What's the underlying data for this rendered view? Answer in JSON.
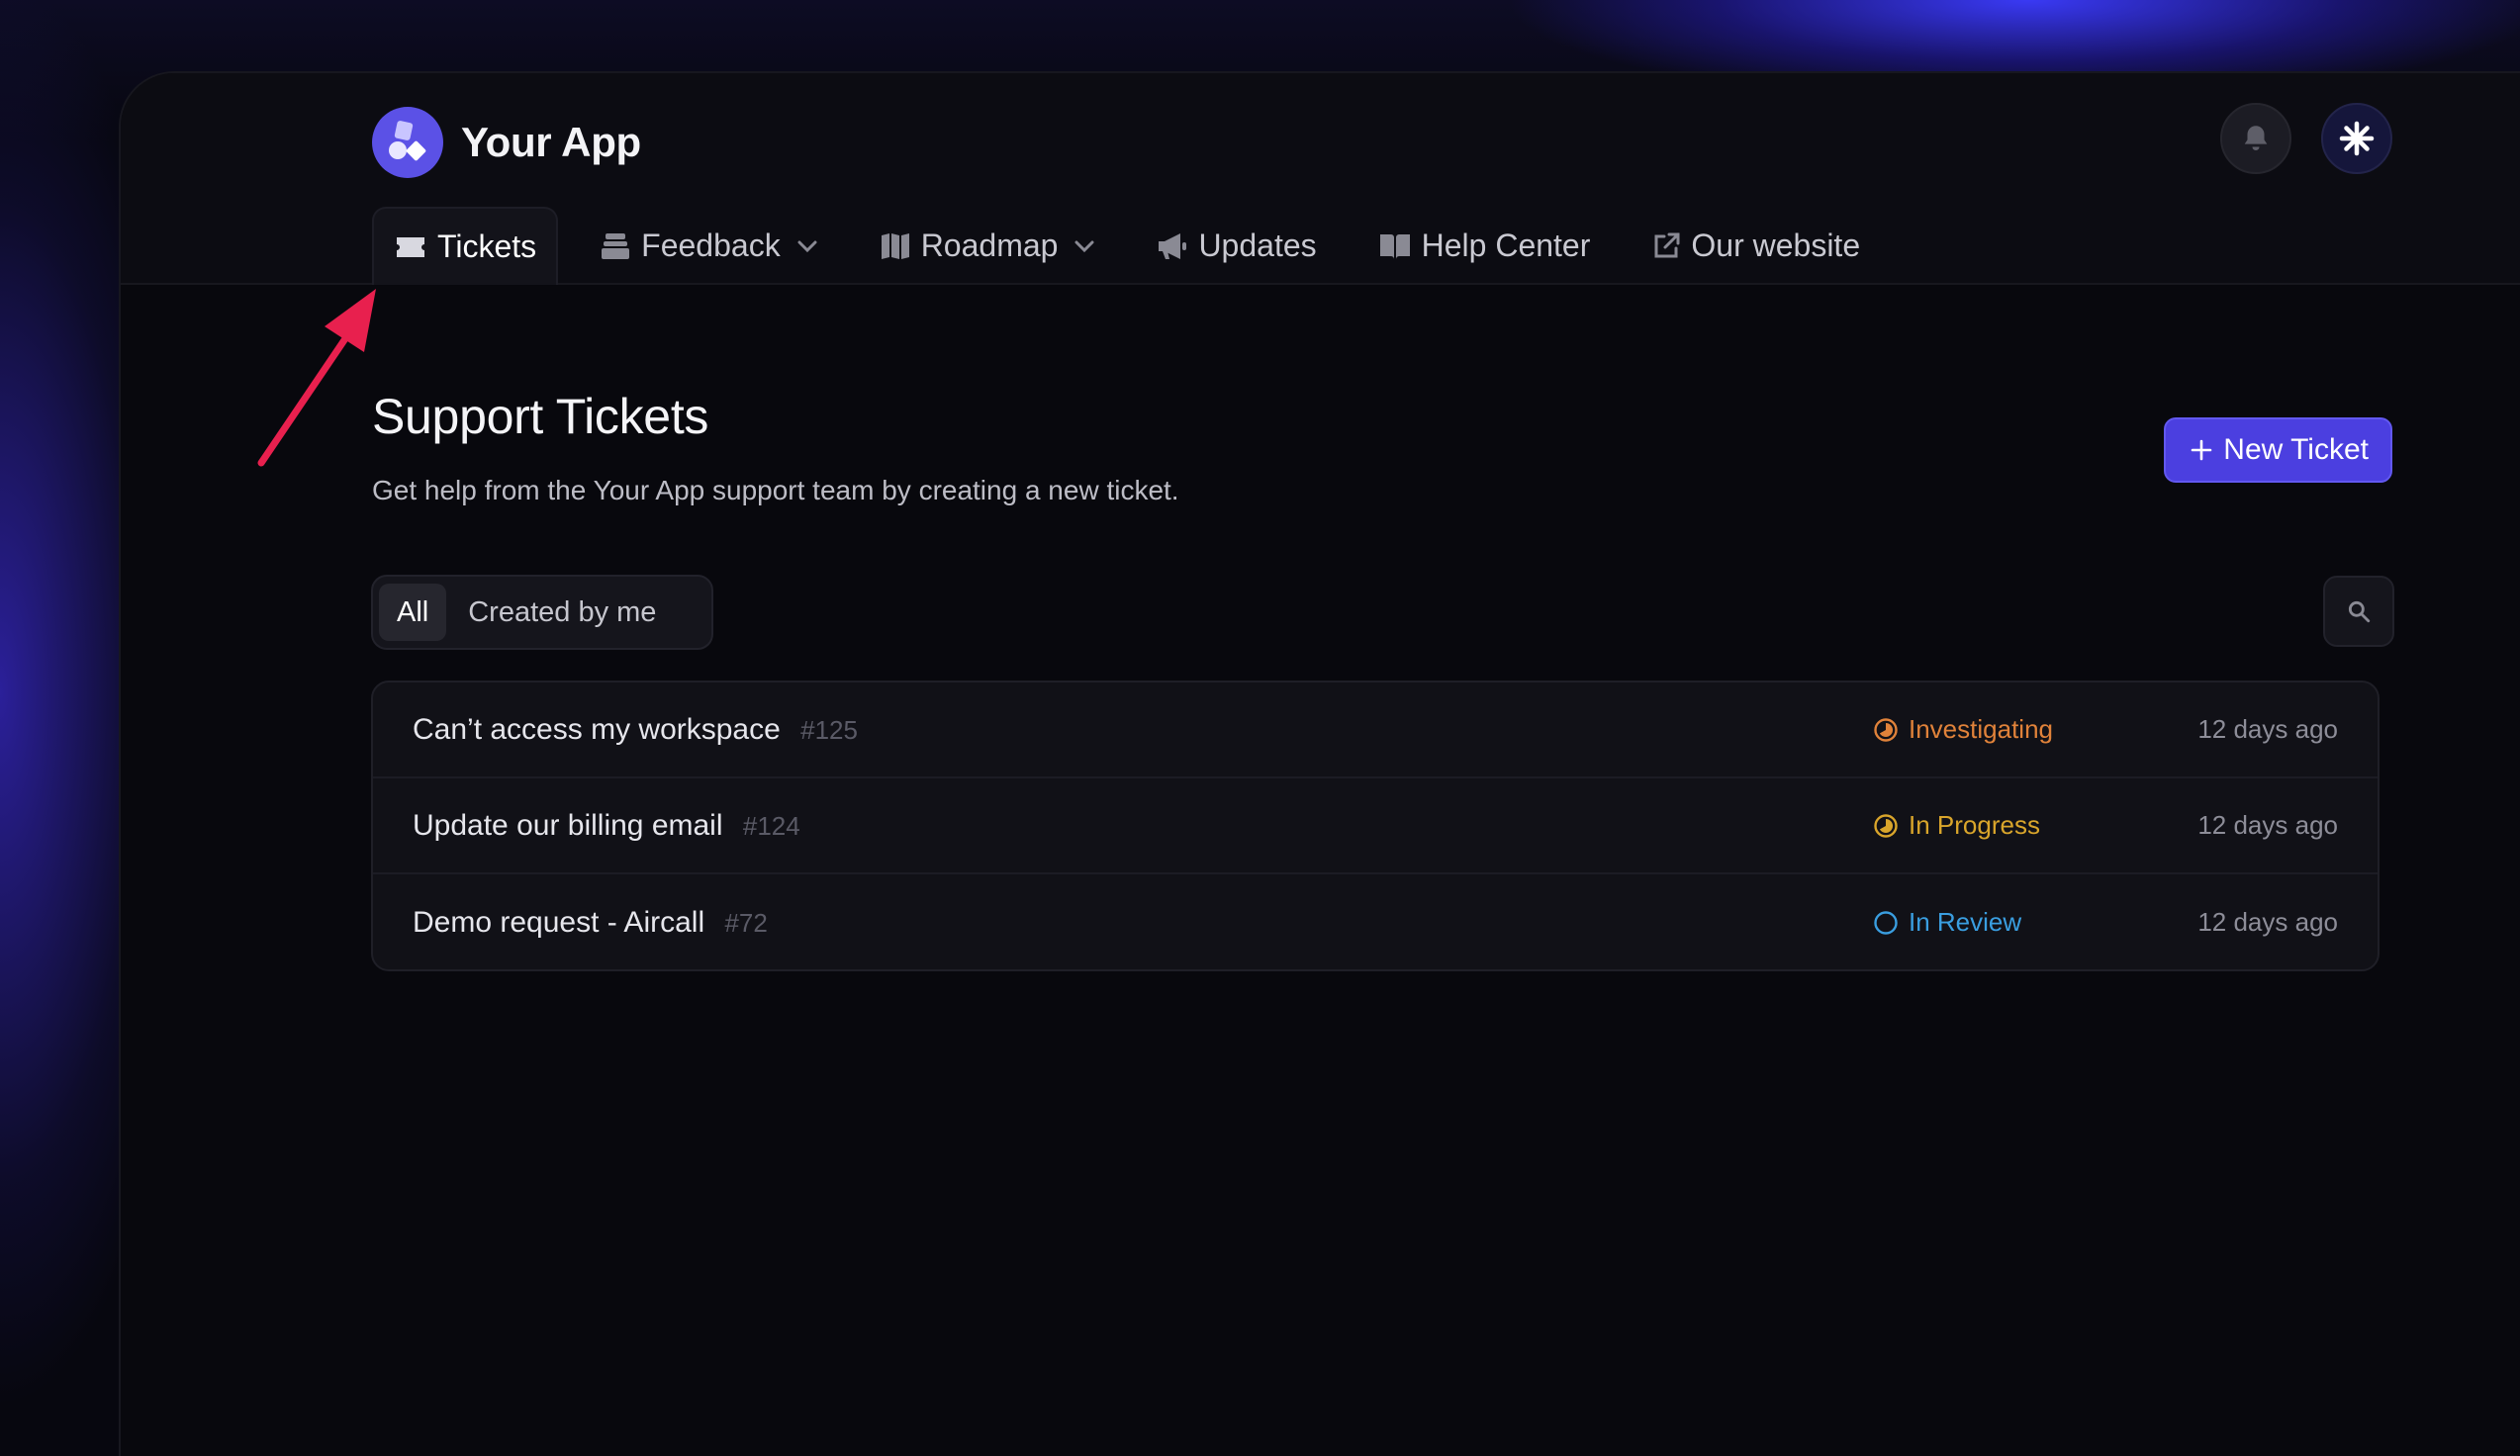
{
  "app": {
    "title": "Your App"
  },
  "nav": {
    "items": [
      {
        "label": "Tickets",
        "icon": "ticket-icon",
        "active": true
      },
      {
        "label": "Feedback",
        "icon": "inbox-icon",
        "dropdown": true
      },
      {
        "label": "Roadmap",
        "icon": "map-icon",
        "dropdown": true
      },
      {
        "label": "Updates",
        "icon": "megaphone-icon"
      },
      {
        "label": "Help Center",
        "icon": "book-icon"
      },
      {
        "label": "Our website",
        "icon": "external-link-icon"
      }
    ]
  },
  "page": {
    "title": "Support Tickets",
    "subtitle": "Get help from the Your App support team by creating a new ticket.",
    "new_ticket_label": "New Ticket"
  },
  "filters": {
    "all": "All",
    "mine": "Created by me"
  },
  "tickets": [
    {
      "title": "Can’t access my workspace",
      "number": "#125",
      "status": "Investigating",
      "status_color": "#e0823a",
      "time": "12 days ago"
    },
    {
      "title": "Update our billing email",
      "number": "#124",
      "status": "In Progress",
      "status_color": "#d9a52b",
      "time": "12 days ago"
    },
    {
      "title": "Demo request - Aircall",
      "number": "#72",
      "status": "In Review",
      "status_color": "#3a9ee0",
      "time": "12 days ago"
    }
  ],
  "colors": {
    "accent": "#4b3fe0",
    "annotation_arrow": "#e8204e"
  }
}
